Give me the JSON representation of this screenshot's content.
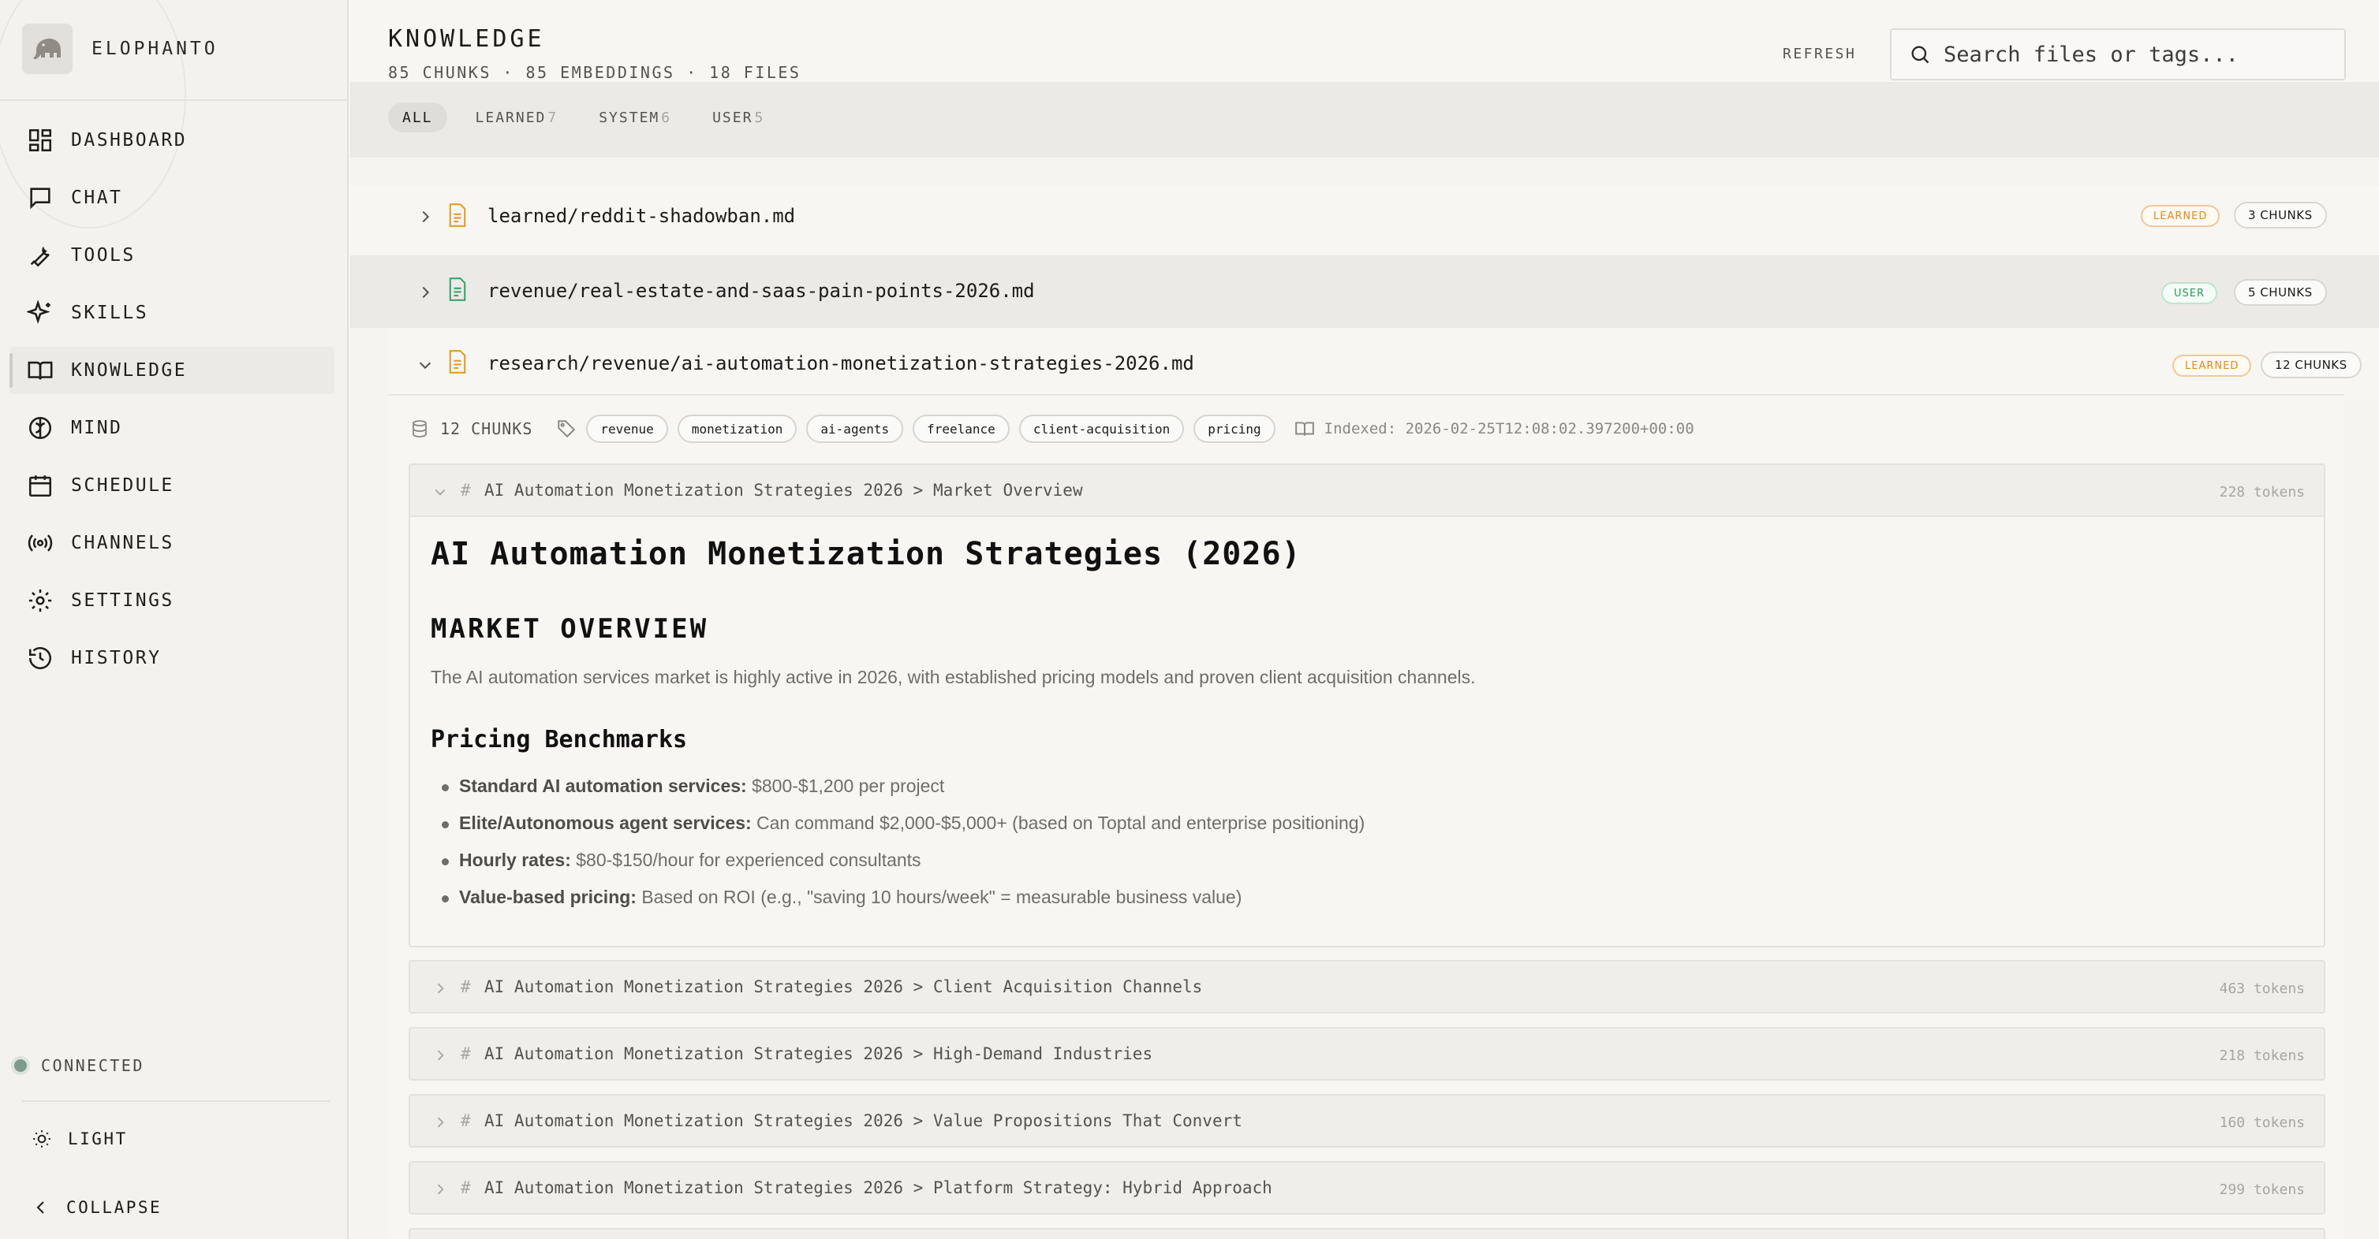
{
  "app": {
    "name": "ELOPHANTO"
  },
  "sidebar": {
    "items": [
      {
        "label": "DASHBOARD",
        "icon": "dashboard-icon",
        "active": false
      },
      {
        "label": "CHAT",
        "icon": "chat-icon",
        "active": false
      },
      {
        "label": "TOOLS",
        "icon": "wrench-icon",
        "active": false
      },
      {
        "label": "SKILLS",
        "icon": "sparkles-icon",
        "active": false
      },
      {
        "label": "KNOWLEDGE",
        "icon": "book-icon",
        "active": true
      },
      {
        "label": "MIND",
        "icon": "brain-icon",
        "active": false
      },
      {
        "label": "SCHEDULE",
        "icon": "calendar-icon",
        "active": false
      },
      {
        "label": "CHANNELS",
        "icon": "broadcast-icon",
        "active": false
      },
      {
        "label": "SETTINGS",
        "icon": "gear-icon",
        "active": false
      },
      {
        "label": "HISTORY",
        "icon": "history-icon",
        "active": false
      }
    ],
    "status": "CONNECTED",
    "theme_label": "LIGHT",
    "collapse_label": "COLLAPSE"
  },
  "header": {
    "title": "KNOWLEDGE",
    "subtitle": "85 CHUNKS · 85 EMBEDDINGS · 18 FILES",
    "refresh_label": "REFRESH",
    "search_placeholder": "Search files or tags..."
  },
  "filters": [
    {
      "label": "ALL",
      "count": "",
      "active": true
    },
    {
      "label": "LEARNED",
      "count": "7",
      "active": false
    },
    {
      "label": "SYSTEM",
      "count": "6",
      "active": false
    },
    {
      "label": "USER",
      "count": "5",
      "active": false
    }
  ],
  "files": [
    {
      "name": "learned/reddit-shadowban.md",
      "badge": "LEARNED",
      "chunks": "3 CHUNKS",
      "expanded": false
    },
    {
      "name": "revenue/real-estate-and-saas-pain-points-2026.md",
      "badge": "USER",
      "chunks": "5 CHUNKS",
      "expanded": false
    },
    {
      "name": "research/revenue/ai-automation-monetization-strategies-2026.md",
      "badge": "LEARNED",
      "chunks": "12 CHUNKS",
      "expanded": true
    }
  ],
  "expanded_file": {
    "chunk_count": "12 CHUNKS",
    "tags": [
      "revenue",
      "monetization",
      "ai-agents",
      "freelance",
      "client-acquisition",
      "pricing"
    ],
    "indexed": "Indexed: 2026-02-25T12:08:02.397200+00:00",
    "hash_symbol": "#",
    "chunks": [
      {
        "title": "AI Automation Monetization Strategies 2026 > Market Overview",
        "tokens": "228 tokens",
        "expanded": true,
        "content": {
          "h1": "AI Automation Monetization Strategies (2026)",
          "h2": "MARKET OVERVIEW",
          "paragraph": "The AI automation services market is highly active in 2026, with established pricing models and proven client acquisition channels.",
          "h3": "Pricing Benchmarks",
          "bullets": [
            {
              "bold": "Standard AI automation services:",
              "text": " $800-$1,200 per project"
            },
            {
              "bold": "Elite/Autonomous agent services:",
              "text": " Can command $2,000-$5,000+ (based on Toptal and enterprise positioning)"
            },
            {
              "bold": "Hourly rates:",
              "text": " $80-$150/hour for experienced consultants"
            },
            {
              "bold": "Value-based pricing:",
              "text": " Based on ROI (e.g., \"saving 10 hours/week\" = measurable business value)"
            }
          ]
        }
      },
      {
        "title": "AI Automation Monetization Strategies 2026 > Client Acquisition Channels",
        "tokens": "463 tokens",
        "expanded": false
      },
      {
        "title": "AI Automation Monetization Strategies 2026 > High-Demand Industries",
        "tokens": "218 tokens",
        "expanded": false
      },
      {
        "title": "AI Automation Monetization Strategies 2026 > Value Propositions That Convert",
        "tokens": "160 tokens",
        "expanded": false
      },
      {
        "title": "AI Automation Monetization Strategies 2026 > Platform Strategy: Hybrid Approach",
        "tokens": "299 tokens",
        "expanded": false
      }
    ]
  },
  "colors": {
    "learned_badge": "#df8a1e",
    "user_badge": "#2c9a5e",
    "connected_dot": "#7d9a8a"
  }
}
